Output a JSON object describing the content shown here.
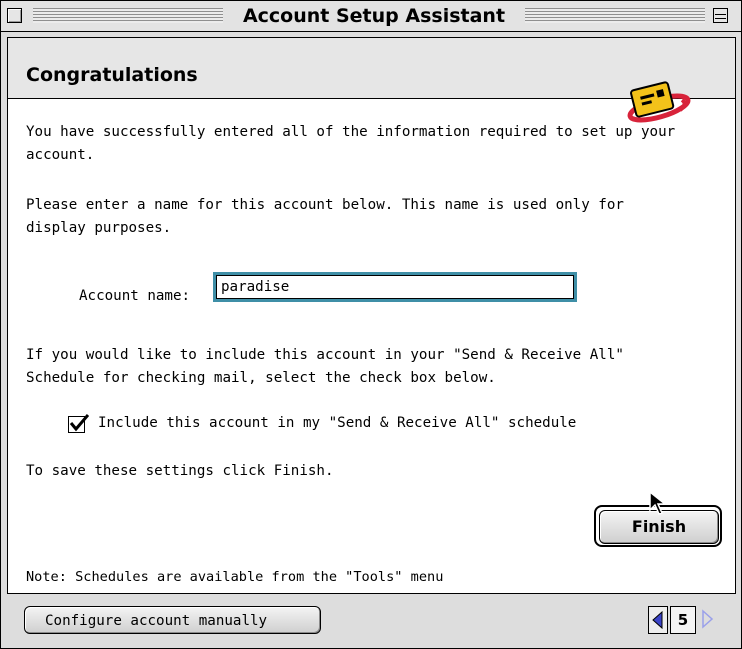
{
  "window": {
    "title": "Account Setup Assistant"
  },
  "page": {
    "heading": "Congratulations",
    "intro_text": "You have successfully entered all of the information required to set up your\naccount.",
    "name_instructions": "Please enter a name for this account below. This name is used only for\ndisplay purposes.",
    "account_name_label": "Account name:",
    "account_name_value": "paradise",
    "schedule_instructions": "If you would like to include this account in your \"Send & Receive All\"\nSchedule for checking mail, select the check box below.",
    "schedule_checkbox_label": "Include this account in my \"Send & Receive All\" schedule",
    "schedule_checkbox_checked": true,
    "save_instructions": "To save these settings click Finish.",
    "finish_label": "Finish",
    "note_text": "Note: Schedules are available from the \"Tools\" menu"
  },
  "footer": {
    "configure_manually_label": "Configure account manually",
    "page_number": "5"
  },
  "icons": {
    "logo": "yellow-mail-card-icon",
    "checkmark": "checkmark-icon",
    "cursor": "pointer-cursor-icon",
    "prev": "triangle-left-icon",
    "next": "triangle-right-icon"
  },
  "colors": {
    "focus_ring": "#3f8fa7",
    "nav_prev_arrow": "#3b44c8",
    "nav_next_arrow": "#9aa0ea",
    "logo_yellow": "#f3c21a",
    "logo_red": "#d8233a"
  }
}
